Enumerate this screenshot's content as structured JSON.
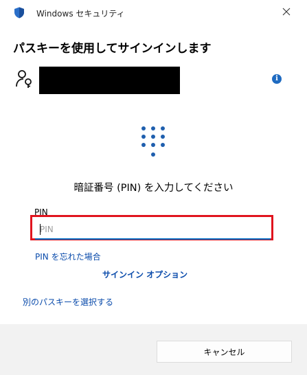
{
  "window": {
    "app_title": "Windows セキュリティ"
  },
  "dialog": {
    "heading": "パスキーを使用してサインインします",
    "pin_prompt": "暗証番号 (PIN) を入力してください",
    "pin_label": "PIN",
    "pin_placeholder": "PIN",
    "pin_value": "",
    "forgot_pin_link": "PIN を忘れた場合",
    "signin_options_link": "サインイン オプション",
    "choose_other_passkey_link": "別のパスキーを選択する",
    "info_glyph": "i"
  },
  "footer": {
    "cancel_label": "キャンセル"
  },
  "icons": {
    "app": "shield-icon",
    "close": "close-icon",
    "account": "account-key-icon",
    "info": "info-icon",
    "keypad": "keypad-icon"
  },
  "colors": {
    "accent": "#0067c0",
    "link": "#0a4bab",
    "highlight_box": "#e0141e",
    "footer_bg": "#f2f2f2",
    "info_badge": "#1f6bc1"
  }
}
